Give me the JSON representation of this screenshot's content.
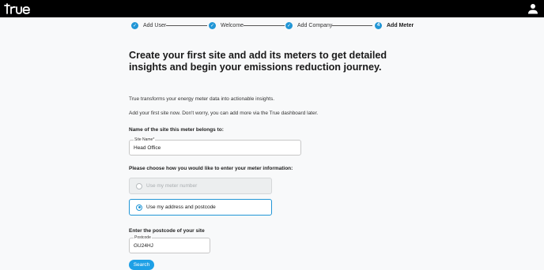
{
  "header": {
    "logo_text": "true",
    "user_icon": "person-icon"
  },
  "stepper": {
    "steps": [
      {
        "label": "Add User",
        "status": "done",
        "marker": "✓"
      },
      {
        "label": "Welcome",
        "status": "done",
        "marker": "✓"
      },
      {
        "label": "Add Company",
        "status": "done",
        "marker": "✓"
      },
      {
        "label": "Add Meter",
        "status": "active",
        "marker": "4"
      }
    ]
  },
  "main": {
    "title": "Create your first site and add its meters to get detailed insights and begin your emissions reduction journey.",
    "intro_1": "True transforms your energy meter data into actionable insights.",
    "intro_2": "Add your first site now. Don't worry, you can add more via the True dashboard later.",
    "site_question": "Name of the site this meter belongs to:",
    "site_field": {
      "label": "Site Name*",
      "value": "Head Office"
    },
    "method_question": "Please choose how you would like to enter your meter information:",
    "options": [
      {
        "label": "Use my meter number",
        "selected": false
      },
      {
        "label": "Use my address and postcode",
        "selected": true
      }
    ],
    "postcode_question": "Enter the postcode of your site",
    "postcode_field": {
      "label": "Postcode",
      "value": "GU24HJ"
    },
    "search_label": "Search"
  },
  "colors": {
    "accent": "#2196d6",
    "button": "#1ea0e6",
    "topbar": "#000000"
  }
}
